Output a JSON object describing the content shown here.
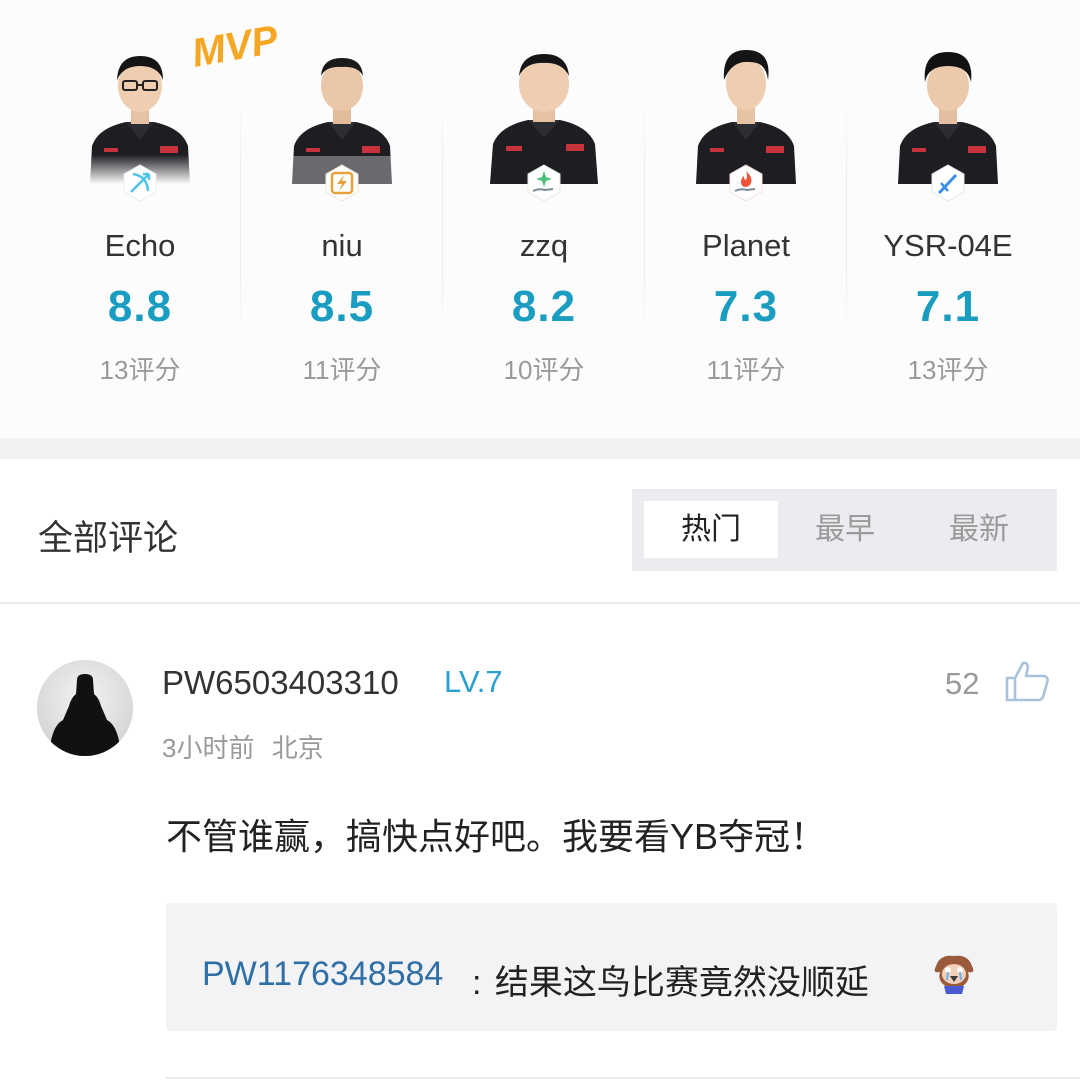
{
  "players": [
    {
      "name": "Echo",
      "score": "8.8",
      "ratings": "13评分",
      "role_icon": "bow-arrow-icon",
      "role_color": "#4fc3e8",
      "mvp": true
    },
    {
      "name": "niu",
      "score": "8.5",
      "ratings": "11评分",
      "role_icon": "lightning-icon",
      "role_color": "#e8a23c",
      "mvp": false
    },
    {
      "name": "zzq",
      "score": "8.2",
      "ratings": "10评分",
      "role_icon": "sparkle-hand-icon",
      "role_color": "#4cc07a",
      "mvp": false
    },
    {
      "name": "Planet",
      "score": "7.3",
      "ratings": "11评分",
      "role_icon": "flame-hand-icon",
      "role_color": "#f0553a",
      "mvp": false
    },
    {
      "name": "YSR-04E",
      "score": "7.1",
      "ratings": "13评分",
      "role_icon": "sword-icon",
      "role_color": "#3b8fe8",
      "mvp": false
    }
  ],
  "mvp_label": "MVP",
  "comments_section": {
    "title": "全部评论",
    "sort_tabs": [
      {
        "label": "热门",
        "active": true
      },
      {
        "label": "最早",
        "active": false
      },
      {
        "label": "最新",
        "active": false
      }
    ]
  },
  "comment": {
    "username": "PW6503403310",
    "level": "LV.7",
    "time": "3小时前",
    "location": "北京",
    "likes": "52",
    "text": "不管谁赢，搞快点好吧。我要看YB夺冠！",
    "reply": {
      "username": "PW1176348584",
      "separator": ":",
      "text": "结果这鸟比赛竟然没顺延",
      "emoji": "crying-bird-emoji"
    }
  },
  "colors": {
    "score": "#1a9dc0",
    "level": "#2a9fd0",
    "reply_user": "#2f6fa6",
    "mvp": "#f5a623"
  }
}
